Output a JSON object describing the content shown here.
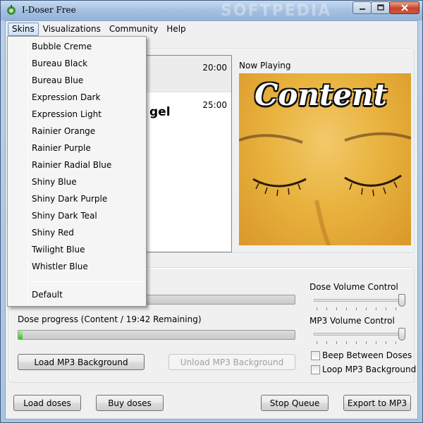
{
  "window": {
    "title": "I-Doser Free",
    "watermark": "SOFTPEDIA"
  },
  "menubar": {
    "items": [
      {
        "label": "Skins"
      },
      {
        "label": "Visualizations"
      },
      {
        "label": "Community"
      },
      {
        "label": "Help"
      }
    ]
  },
  "skins_menu": {
    "items": [
      "Bubble Creme",
      "Bureau Black",
      "Bureau Blue",
      "Expression Dark",
      "Expression Light",
      "Rainier Orange",
      "Rainier Purple",
      "Rainier Radial Blue",
      "Shiny Blue",
      "Shiny Dark Purple",
      "Shiny Dark Teal",
      "Shiny Red",
      "Twilight Blue",
      "Whistler Blue"
    ],
    "default_label": "Default"
  },
  "playlist": {
    "rows": [
      {
        "time": "20:00",
        "title": ""
      },
      {
        "time": "25:00",
        "title": "gel"
      }
    ]
  },
  "now_playing": {
    "label": "Now Playing",
    "art_text": "Content"
  },
  "dose": {
    "progress_label": "Dose progress (Content / 19:42 Remaining)",
    "progress_fraction": 0.015,
    "load_mp3_label": "Load MP3 Background",
    "unload_mp3_label": "Unload MP3 Background"
  },
  "volume": {
    "dose_label": "Dose Volume Control",
    "mp3_label": "MP3 Volume Control",
    "dose_level": 1.0,
    "mp3_level": 1.0
  },
  "options": {
    "beep_label": "Beep Between Doses",
    "loop_label": "Loop MP3 Background"
  },
  "footer": {
    "load_doses": "Load doses",
    "buy_doses": "Buy doses",
    "stop_queue": "Stop Queue",
    "export_mp3": "Export to MP3"
  },
  "colors": {
    "progress_fill": "#3fb92b",
    "art_background": "#e9b33f"
  }
}
